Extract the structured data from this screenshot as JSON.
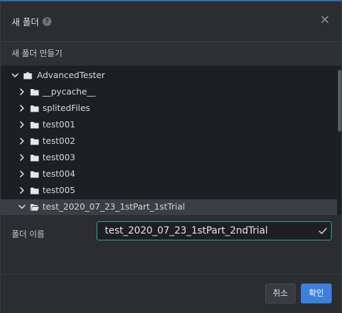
{
  "dialog": {
    "title": "새 폴더",
    "help_icon": "help-icon",
    "close_icon": "close-icon",
    "close_glyph": "✕"
  },
  "section": {
    "subtitle": "새 폴더 만들기"
  },
  "tree": {
    "items": [
      {
        "label": "AdvancedTester",
        "expanded": true,
        "level": 0,
        "selected": false,
        "icon": "package-folder-icon"
      },
      {
        "label": "__pycache__",
        "expanded": false,
        "level": 1,
        "selected": false,
        "icon": "folder-icon"
      },
      {
        "label": "splitedFiles",
        "expanded": false,
        "level": 1,
        "selected": false,
        "icon": "folder-icon"
      },
      {
        "label": "test001",
        "expanded": false,
        "level": 1,
        "selected": false,
        "icon": "folder-icon"
      },
      {
        "label": "test002",
        "expanded": false,
        "level": 1,
        "selected": false,
        "icon": "folder-icon"
      },
      {
        "label": "test003",
        "expanded": false,
        "level": 1,
        "selected": false,
        "icon": "folder-icon"
      },
      {
        "label": "test004",
        "expanded": false,
        "level": 1,
        "selected": false,
        "icon": "folder-icon"
      },
      {
        "label": "test005",
        "expanded": false,
        "level": 1,
        "selected": false,
        "icon": "folder-icon"
      },
      {
        "label": "test_2020_07_23_1stPart_1stTrial",
        "expanded": true,
        "level": 1,
        "selected": true,
        "icon": "open-folder-icon"
      }
    ]
  },
  "form": {
    "name_label": "폴더 이름",
    "name_value": "test_2020_07_23_1stPart_2ndTrial",
    "valid_icon": "check-icon"
  },
  "footer": {
    "cancel_label": "취소",
    "ok_label": "확인"
  },
  "colors": {
    "accent": "#3d7fd9",
    "input_border": "#2fa8a0",
    "selected_row": "#3b3e44"
  }
}
